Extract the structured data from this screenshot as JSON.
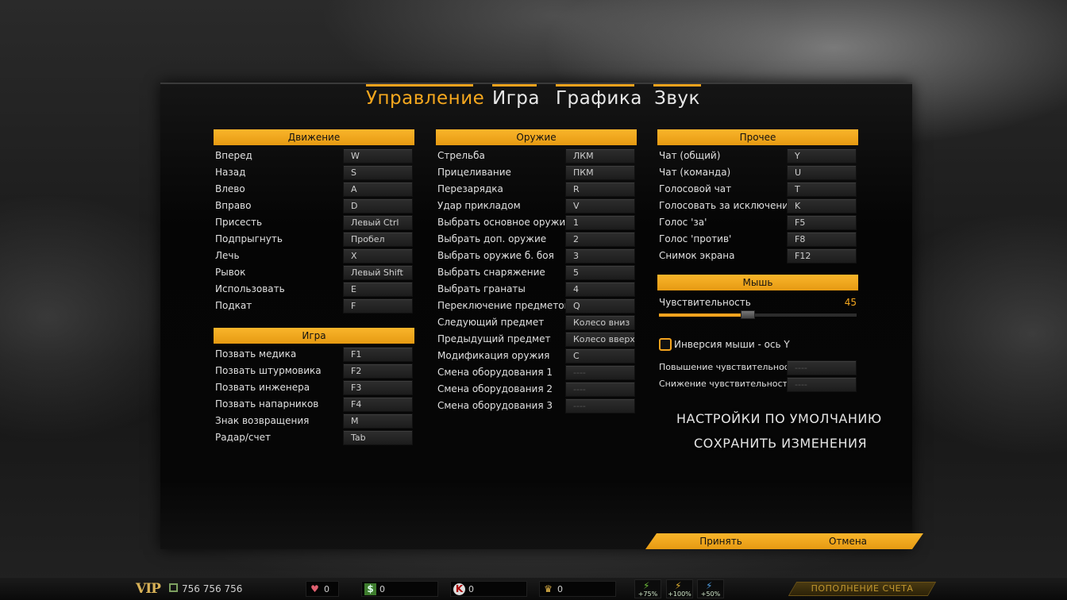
{
  "tabs": [
    {
      "label": "Управление",
      "active": true
    },
    {
      "label": "Игра",
      "active": false
    },
    {
      "label": "Графика",
      "active": false
    },
    {
      "label": "Звук",
      "active": false
    }
  ],
  "movement": {
    "title": "Движение",
    "rows": [
      {
        "label": "Вперед",
        "key": "W"
      },
      {
        "label": "Назад",
        "key": "S"
      },
      {
        "label": "Влево",
        "key": "A"
      },
      {
        "label": "Вправо",
        "key": "D"
      },
      {
        "label": "Присесть",
        "key": "Левый Ctrl"
      },
      {
        "label": "Подпрыгнуть",
        "key": "Пробел"
      },
      {
        "label": "Лечь",
        "key": "X"
      },
      {
        "label": "Рывок",
        "key": "Левый Shift"
      },
      {
        "label": "Использовать",
        "key": "E"
      },
      {
        "label": "Подкат",
        "key": "F"
      }
    ]
  },
  "game": {
    "title": "Игра",
    "rows": [
      {
        "label": "Позвать медика",
        "key": "F1"
      },
      {
        "label": "Позвать штурмовика",
        "key": "F2"
      },
      {
        "label": "Позвать инженера",
        "key": "F3"
      },
      {
        "label": "Позвать напарников",
        "key": "F4"
      },
      {
        "label": "Знак возвращения",
        "key": "M"
      },
      {
        "label": "Радар/счет",
        "key": "Tab"
      }
    ]
  },
  "weapons": {
    "title": "Оружие",
    "rows": [
      {
        "label": "Стрельба",
        "key": "ЛКМ"
      },
      {
        "label": "Прицеливание",
        "key": "ПКМ"
      },
      {
        "label": "Перезарядка",
        "key": "R"
      },
      {
        "label": "Удар прикладом",
        "key": "V"
      },
      {
        "label": "Выбрать основное оружие",
        "key": "1"
      },
      {
        "label": "Выбрать доп. оружие",
        "key": "2"
      },
      {
        "label": "Выбрать оружие б. боя",
        "key": "3"
      },
      {
        "label": "Выбрать снаряжение",
        "key": "5"
      },
      {
        "label": "Выбрать гранаты",
        "key": "4"
      },
      {
        "label": "Переключение предметов",
        "key": "Q"
      },
      {
        "label": "Следующий предмет",
        "key": "Колесо вниз"
      },
      {
        "label": "Предыдущий предмет",
        "key": "Колесо вверх"
      },
      {
        "label": "Модификация оружия",
        "key": "C"
      },
      {
        "label": "Смена оборудования 1",
        "key": "----"
      },
      {
        "label": "Смена оборудования 2",
        "key": "----"
      },
      {
        "label": "Смена оборудования 3",
        "key": "----"
      }
    ]
  },
  "other": {
    "title": "Прочее",
    "rows": [
      {
        "label": "Чат (общий)",
        "key": "Y"
      },
      {
        "label": "Чат (команда)",
        "key": "U"
      },
      {
        "label": "Голосовой чат",
        "key": "T"
      },
      {
        "label": "Голосовать за исключение",
        "key": "K"
      },
      {
        "label": "Голос 'за'",
        "key": "F5"
      },
      {
        "label": "Голос 'против'",
        "key": "F8"
      },
      {
        "label": "Снимок экрана",
        "key": "F12"
      }
    ]
  },
  "mouse": {
    "title": "Мышь",
    "sensitivity_label": "Чувствительность",
    "sensitivity_value": "45",
    "sensitivity_fraction": 0.45,
    "invert_label": "Инверсия мыши - ось Y",
    "invert_checked": false,
    "rows": [
      {
        "label": "Повышение чувствительности",
        "key": "----"
      },
      {
        "label": "Снижение чувствительности",
        "key": "----"
      }
    ]
  },
  "actions": {
    "defaults": "НАСТРОЙКИ ПО УМОЛЧАНИЮ",
    "save": "СОХРАНИТЬ ИЗМЕНЕНИЯ",
    "accept": "Принять",
    "cancel": "Отмена"
  },
  "bottombar": {
    "vip": "VIP",
    "user_id": "756 756 756",
    "resources": [
      {
        "icon": "heart-icon",
        "value": "0"
      },
      {
        "icon": "dollar-icon",
        "value": "0"
      },
      {
        "icon": "k-coin-icon",
        "value": "0"
      },
      {
        "icon": "crown-icon",
        "value": "0"
      }
    ],
    "boosts": [
      {
        "icon": "xp-boost-icon",
        "label": "+75%",
        "color": "#6fbf3a"
      },
      {
        "icon": "money-boost-icon",
        "label": "+100%",
        "color": "#e0b030"
      },
      {
        "icon": "rank-boost-icon",
        "label": "+50%",
        "color": "#4f9de0"
      }
    ],
    "topup": "ПОПОЛНЕНИЕ СЧЕТА"
  },
  "colors": {
    "accent": "#f3a31e",
    "panel": "#0a0a0a"
  }
}
